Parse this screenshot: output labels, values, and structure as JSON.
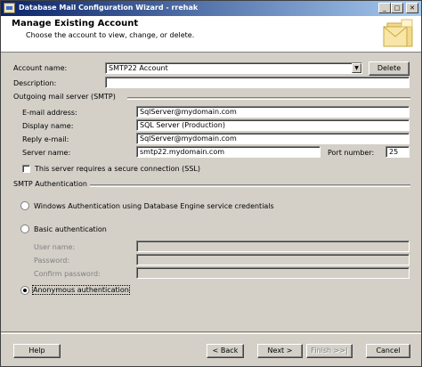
{
  "window": {
    "title": "Database Mail Configuration Wizard - rrehak"
  },
  "header": {
    "title": "Manage Existing Account",
    "subtitle": "Choose the account to view, change, or delete."
  },
  "account": {
    "name_label": "Account name:",
    "name_value": "SMTP22 Account",
    "delete_label": "Delete",
    "description_label": "Description:",
    "description_value": ""
  },
  "outgoing": {
    "group_label": "Outgoing mail server (SMTP)",
    "email_label": "E-mail address:",
    "email_value": "SqlServer@mydomain.com",
    "display_label": "Display name:",
    "display_value": "SQL Server (Production)",
    "reply_label": "Reply e-mail:",
    "reply_value": "SqlServer@mydomain.com",
    "server_label": "Server name:",
    "server_value": "smtp22.mydomain.com",
    "port_label": "Port number:",
    "port_value": "25",
    "ssl_label": "This server requires a secure connection (SSL)",
    "ssl_checked": false
  },
  "auth": {
    "group_label": "SMTP Authentication",
    "windows_label": "Windows Authentication using Database Engine service credentials",
    "basic_label": "Basic authentication",
    "username_label": "User name:",
    "password_label": "Password:",
    "confirm_label": "Confirm password:",
    "anonymous_label": "Anonymous authentication",
    "selected": "anonymous"
  },
  "footer": {
    "help_label": "Help",
    "back_label": "< Back",
    "next_label": "Next >",
    "finish_label": "Finish >>|",
    "cancel_label": "Cancel"
  },
  "colors": {
    "title_start": "#0a246a",
    "title_end": "#a6caf0",
    "face": "#d4d0c8"
  }
}
